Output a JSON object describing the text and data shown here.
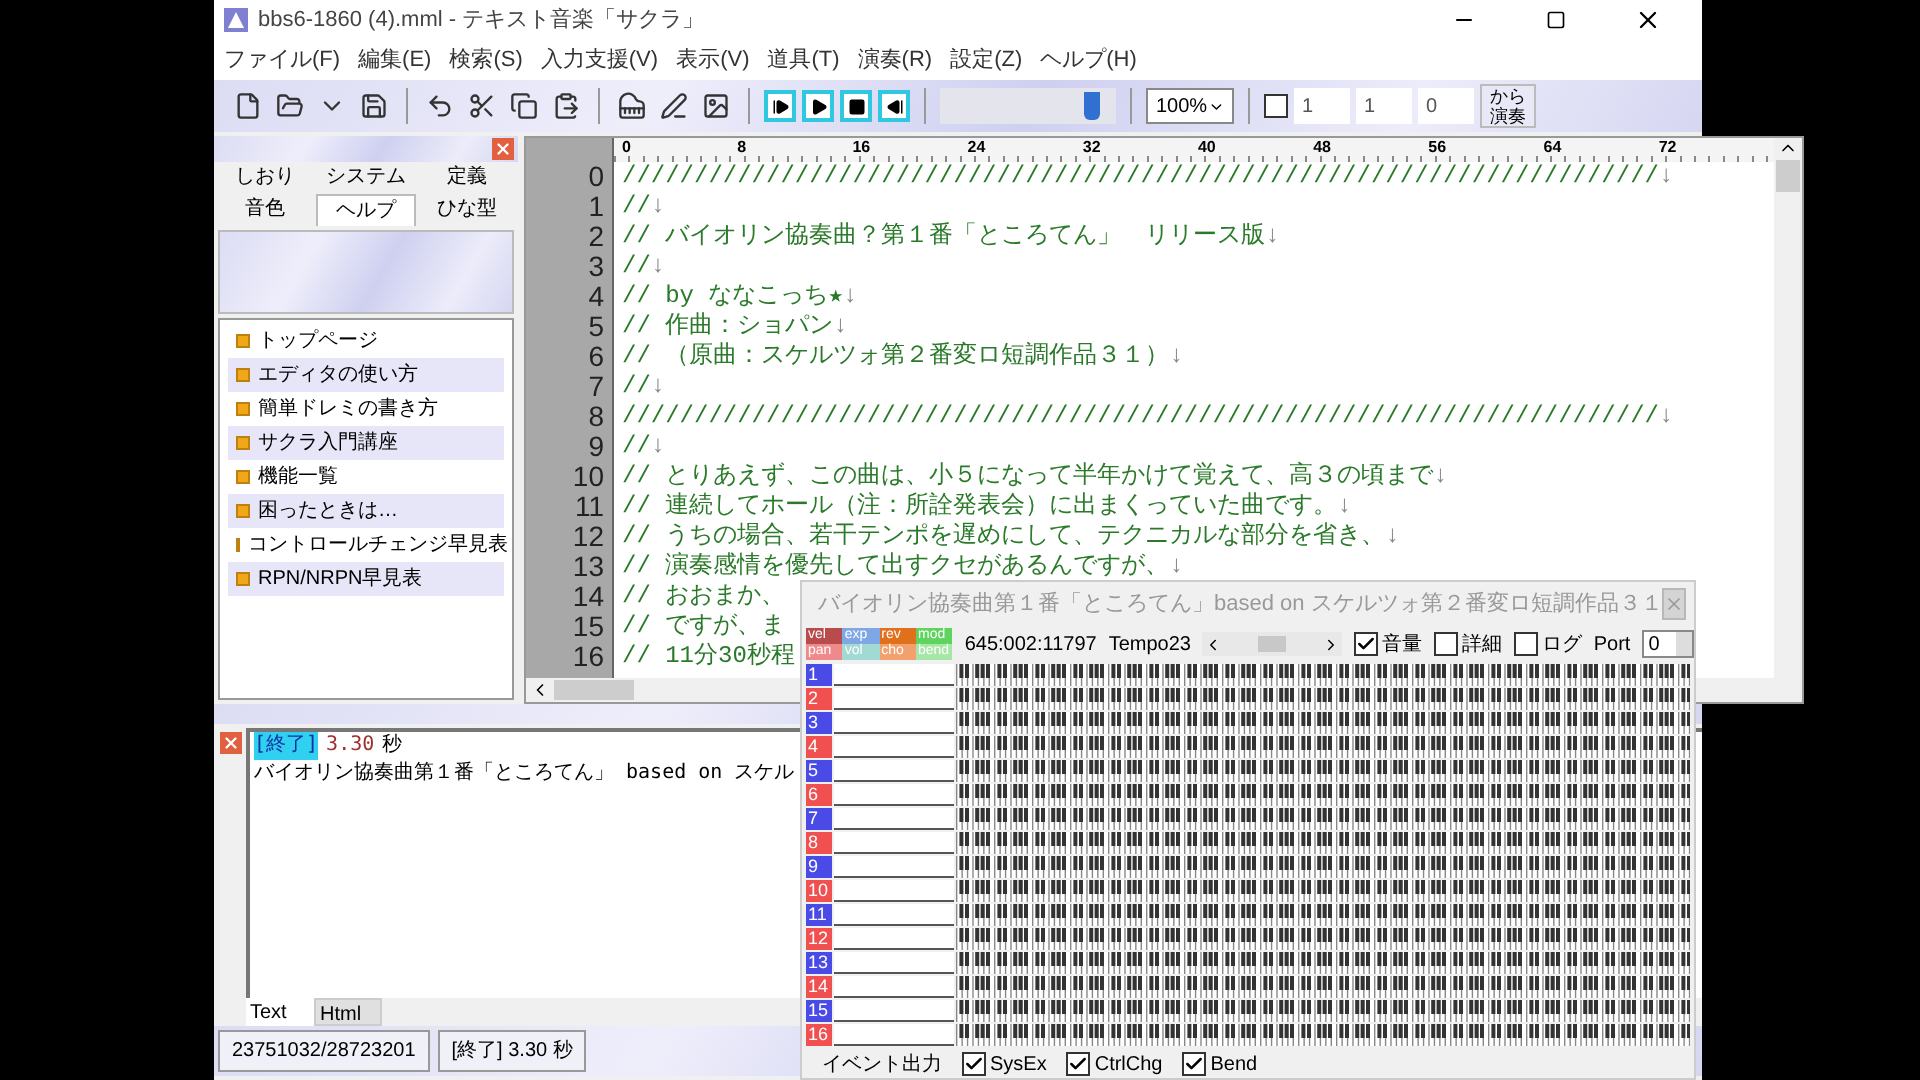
{
  "window": {
    "title": "bbs6-1860 (4).mml - テキスト音楽「サクラ」"
  },
  "menu": [
    "ファイル(F)",
    "編集(E)",
    "検索(S)",
    "入力支援(V)",
    "表示(V)",
    "道具(T)",
    "演奏(R)",
    "設定(Z)",
    "ヘルプ(H)"
  ],
  "toolbar": {
    "slider": {
      "level": 0.86
    },
    "zoom": "100%",
    "loop": {
      "checked": false
    },
    "fields": [
      "1",
      "1",
      "0"
    ],
    "play_from": [
      "から",
      "演奏"
    ]
  },
  "side_panel": {
    "tabs": [
      {
        "label": "しおり",
        "selected": false
      },
      {
        "label": "システム",
        "selected": false
      },
      {
        "label": "定義",
        "selected": false
      },
      {
        "label": "音色",
        "selected": false
      },
      {
        "label": "ヘルプ",
        "selected": true
      },
      {
        "label": "ひな型",
        "selected": false
      }
    ],
    "items": [
      "トップページ",
      "エディタの使い方",
      "簡単ドレミの書き方",
      "サクラ入門講座",
      "機能一覧",
      "困ったときは…",
      "コントロールチェンジ早見表",
      "RPN/NRPN早見表"
    ]
  },
  "editor": {
    "ruler": [
      "0",
      "8",
      "16",
      "24",
      "32",
      "40",
      "48",
      "56",
      "64",
      "72"
    ],
    "lines": [
      {
        "number": "0",
        "text": "////////////////////////////////////////////////////////////////////////",
        "eol": "↓"
      },
      {
        "number": "1",
        "text": "//",
        "eol": "↓"
      },
      {
        "number": "2",
        "text": "// バイオリン協奏曲？第１番「ところてん」　リリース版",
        "eol": "↓"
      },
      {
        "number": "3",
        "text": "//",
        "eol": "↓"
      },
      {
        "number": "4",
        "text": "// by ななこっち★",
        "eol": "↓"
      },
      {
        "number": "5",
        "text": "// 作曲：ショパン",
        "eol": "↓"
      },
      {
        "number": "6",
        "text": "// （原曲：スケルツォ第２番変ロ短調作品３１）",
        "eol": "↓"
      },
      {
        "number": "7",
        "text": "//",
        "eol": "↓"
      },
      {
        "number": "8",
        "text": "////////////////////////////////////////////////////////////////////////",
        "eol": "↓"
      },
      {
        "number": "9",
        "text": "//",
        "eol": "↓"
      },
      {
        "number": "10",
        "text": "// とりあえず、この曲は、小５になって半年かけて覚えて、高３の頃まで",
        "eol": "↓"
      },
      {
        "number": "11",
        "text": "// 連続してホール（注：所詮発表会）に出まくっていた曲です。",
        "eol": "↓"
      },
      {
        "number": "12",
        "text": "// うちの場合、若干テンポを遅めにして、テクニカルな部分を省き、",
        "eol": "↓"
      },
      {
        "number": "13",
        "text": "// 演奏感情を優先して出すクセがあるんですが、",
        "eol": "↓"
      },
      {
        "number": "14",
        "text": "// おおまか、"
      },
      {
        "number": "15",
        "text": "// ですが、ま"
      },
      {
        "number": "16",
        "text": "// 11分30秒程"
      }
    ]
  },
  "output": {
    "tag": "[終了]",
    "time": "3.30",
    "unit": "秒",
    "message": "バイオリン協奏曲第１番「ところてん」 based on スケル",
    "tabs": [
      {
        "label": "Text",
        "selected": true
      },
      {
        "label": "Html",
        "selected": false
      }
    ]
  },
  "status_bar": [
    "23751032/28723201",
    "[終了] 3.30 秒"
  ],
  "keyboard_window": {
    "title": "バイオリン協奏曲第１番「ところてん」based on スケルツォ第２番変ロ短調作品３１",
    "legend": [
      {
        "label": "vel",
        "color": "#b84c4c"
      },
      {
        "label": "exp",
        "color": "#7fa7e6"
      },
      {
        "label": "rev",
        "color": "#e0701c"
      },
      {
        "label": "mod",
        "color": "#5ed45e"
      },
      {
        "label": "pan",
        "color": "#f08a8a"
      },
      {
        "label": "vol",
        "color": "#a2d9d2"
      },
      {
        "label": "cho",
        "color": "#f2a06e"
      },
      {
        "label": "bend",
        "color": "#a6e6a6"
      }
    ],
    "position": "645:002:11797",
    "tempo": "Tempo23",
    "options": [
      {
        "label": "音量",
        "checked": true
      },
      {
        "label": "詳細",
        "checked": false
      },
      {
        "label": "ログ",
        "checked": false
      }
    ],
    "port_label": "Port",
    "port": "0",
    "channels": [
      {
        "number": "1",
        "color": "#4a4ae6"
      },
      {
        "number": "2",
        "color": "#f05050"
      },
      {
        "number": "3",
        "color": "#4a4ae6"
      },
      {
        "number": "4",
        "color": "#f05050"
      },
      {
        "number": "5",
        "color": "#4a4ae6"
      },
      {
        "number": "6",
        "color": "#f05050"
      },
      {
        "number": "7",
        "color": "#4a4ae6"
      },
      {
        "number": "8",
        "color": "#f05050"
      },
      {
        "number": "9",
        "color": "#4a4ae6"
      },
      {
        "number": "10",
        "color": "#f05050"
      },
      {
        "number": "11",
        "color": "#4a4ae6"
      },
      {
        "number": "12",
        "color": "#f05050"
      },
      {
        "number": "13",
        "color": "#4a4ae6"
      },
      {
        "number": "14",
        "color": "#f05050"
      },
      {
        "number": "15",
        "color": "#4a4ae6"
      },
      {
        "number": "16",
        "color": "#f05050"
      }
    ],
    "footer_label": "イベント出力",
    "outputs": [
      {
        "label": "SysEx",
        "checked": true
      },
      {
        "label": "CtrlChg",
        "checked": true
      },
      {
        "label": "Bend",
        "checked": true
      }
    ]
  }
}
